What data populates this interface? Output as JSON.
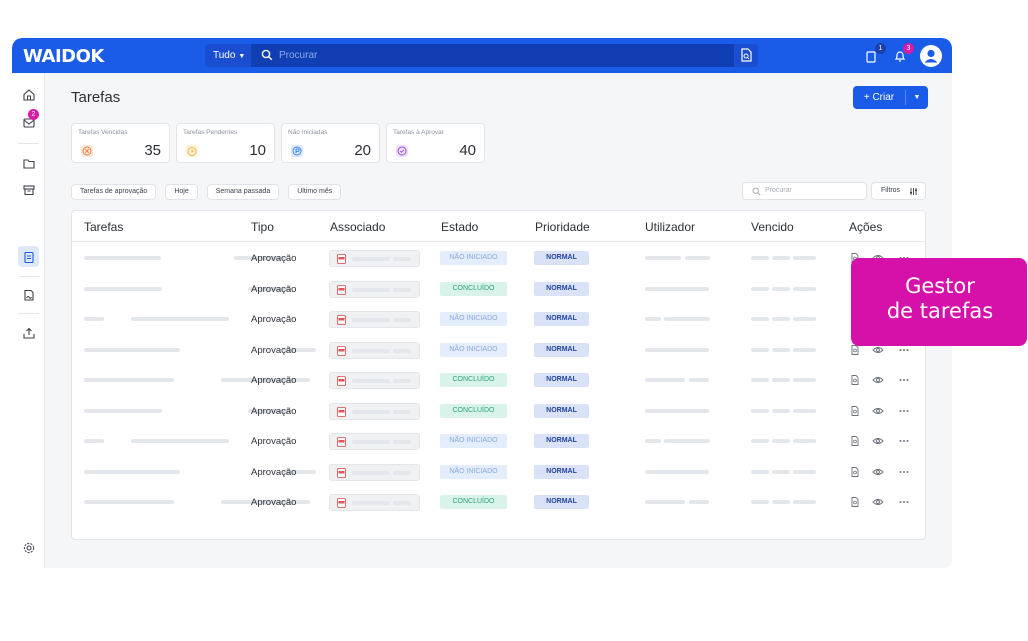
{
  "app": {
    "logo": "WAIDOK",
    "search": {
      "scope": "Tudo",
      "placeholder": "Procurar"
    },
    "notifications": {
      "docs_badge": "1",
      "alerts_badge": "3"
    }
  },
  "sidebar": {
    "items": [
      "home-icon",
      "inbox-icon",
      "folder-icon",
      "archive-icon",
      "tasks-icon",
      "signature-icon",
      "upload-icon",
      "settings-icon"
    ],
    "inbox_badge": "2",
    "active": "tasks-icon"
  },
  "page": {
    "title": "Tarefas",
    "create_label": "+ Criar"
  },
  "kpis": [
    {
      "label": "Tarefas Vencidas",
      "value": "35",
      "icon": "overdue-icon",
      "color": "#f07c3f"
    },
    {
      "label": "Tarefas Pendentes",
      "value": "10",
      "icon": "clock-icon",
      "color": "#f2b84b"
    },
    {
      "label": "Não Iniciadas",
      "value": "20",
      "icon": "not-started-icon",
      "color": "#3d8ae8"
    },
    {
      "label": "Tarefas à Aprovar",
      "value": "40",
      "icon": "approve-icon",
      "color": "#9b4fd6"
    }
  ],
  "filters": {
    "chips": [
      "Tarefas de aprovação",
      "Hoje",
      "Semana passada",
      "Último mês"
    ],
    "search_placeholder": "Procurar",
    "filter_label": "Filtros"
  },
  "table": {
    "columns": [
      "Tarefas",
      "Tipo",
      "Associado",
      "Estado",
      "Prioridade",
      "Utilizador",
      "Vencido",
      "Ações"
    ],
    "rows": [
      {
        "tipo": "Aprovação",
        "estado": "NÃO INICIADO",
        "estado_kind": "pending",
        "prioridade": "NORMAL"
      },
      {
        "tipo": "Aprovação",
        "estado": "CONCLUÍDO",
        "estado_kind": "done",
        "prioridade": "NORMAL"
      },
      {
        "tipo": "Aprovação",
        "estado": "NÃO INICIADO",
        "estado_kind": "pending",
        "prioridade": "NORMAL"
      },
      {
        "tipo": "Aprovação",
        "estado": "NÃO INICIADO",
        "estado_kind": "pending",
        "prioridade": "NORMAL"
      },
      {
        "tipo": "Aprovação",
        "estado": "CONCLUÍDO",
        "estado_kind": "done",
        "prioridade": "NORMAL"
      },
      {
        "tipo": "Aprovação",
        "estado": "CONCLUÍDO",
        "estado_kind": "done",
        "prioridade": "NORMAL"
      },
      {
        "tipo": "Aprovação",
        "estado": "NÃO INICIADO",
        "estado_kind": "pending",
        "prioridade": "NORMAL"
      },
      {
        "tipo": "Aprovação",
        "estado": "NÃO INICIADO",
        "estado_kind": "pending",
        "prioridade": "NORMAL"
      },
      {
        "tipo": "Aprovação",
        "estado": "CONCLUÍDO",
        "estado_kind": "done",
        "prioridade": "NORMAL"
      }
    ]
  },
  "callout": {
    "line1": "Gestor",
    "line2": "de tarefas"
  },
  "colors": {
    "brand": "#1a5be8",
    "accent": "#d511aa"
  }
}
